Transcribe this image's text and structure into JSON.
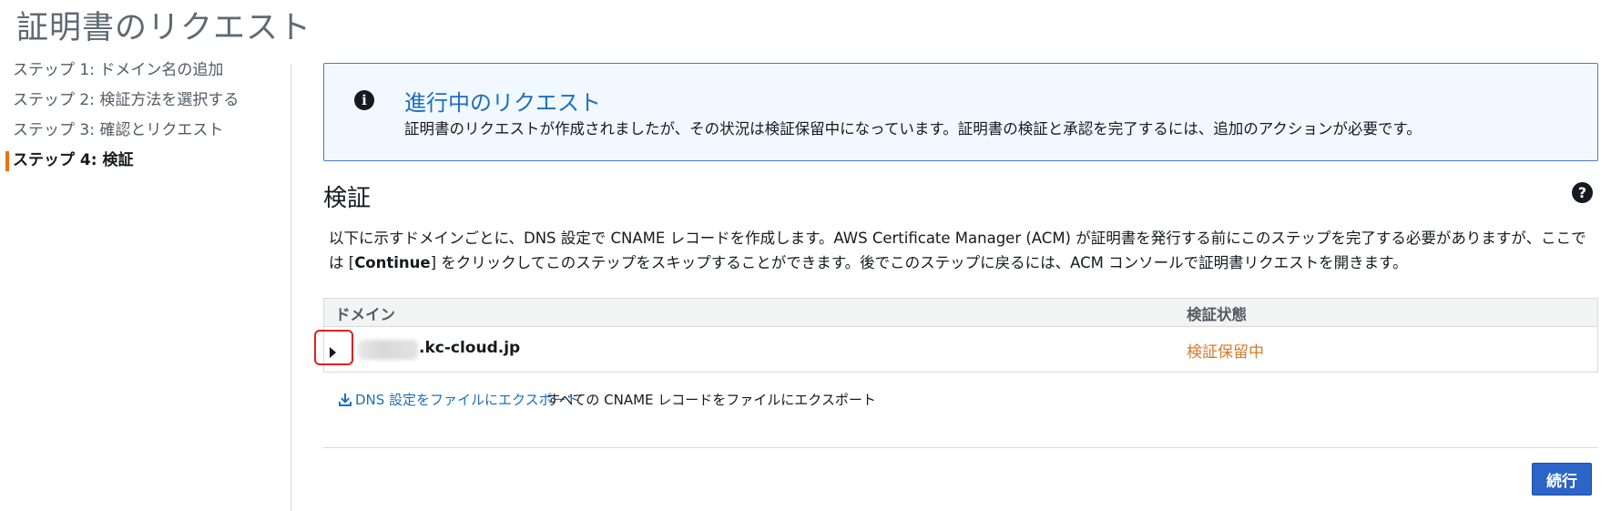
{
  "page": {
    "title": "証明書のリクエスト"
  },
  "steps": [
    {
      "label": "ステップ 1: ドメイン名の追加"
    },
    {
      "label": "ステップ 2: 検証方法を選択する"
    },
    {
      "label": "ステップ 3: 確認とリクエスト"
    },
    {
      "label": "ステップ 4: 検証",
      "active": true
    }
  ],
  "alert": {
    "icon": "info-icon",
    "title": "進行中のリクエスト",
    "body": "証明書のリクエストが作成されましたが、その状況は検証保留中になっています。証明書の検証と承認を完了するには、追加のアクションが必要です。"
  },
  "validation": {
    "title": "検証",
    "help_icon": "help-icon",
    "description_part1": "以下に示すドメインごとに、DNS 設定で CNAME レコードを作成します。AWS Certificate Manager (ACM) が証明書を発行する前にこのステップを完了する必要がありますが、ここでは [",
    "description_bold": "Continue",
    "description_part2": "] をクリックしてこのステップをスキップすることができます。後でこのステップに戻るには、ACM コンソールで証明書リクエストを開きます。"
  },
  "table": {
    "columns": [
      "ドメイン",
      "検証状態"
    ],
    "rows": [
      {
        "domain": ".kc-cloud.jp",
        "status": "検証保留中",
        "status_color": "#d5792a"
      }
    ]
  },
  "export": {
    "dns_link": "DNS 設定をファイルにエクスポート",
    "cname_text": "すべての CNAME レコードをファイルにエクスポート"
  },
  "footer": {
    "continue_label": "続行"
  },
  "colors": {
    "accent": "#ec7211",
    "link": "#1d6fbd",
    "primary_button": "#2c64c7"
  }
}
